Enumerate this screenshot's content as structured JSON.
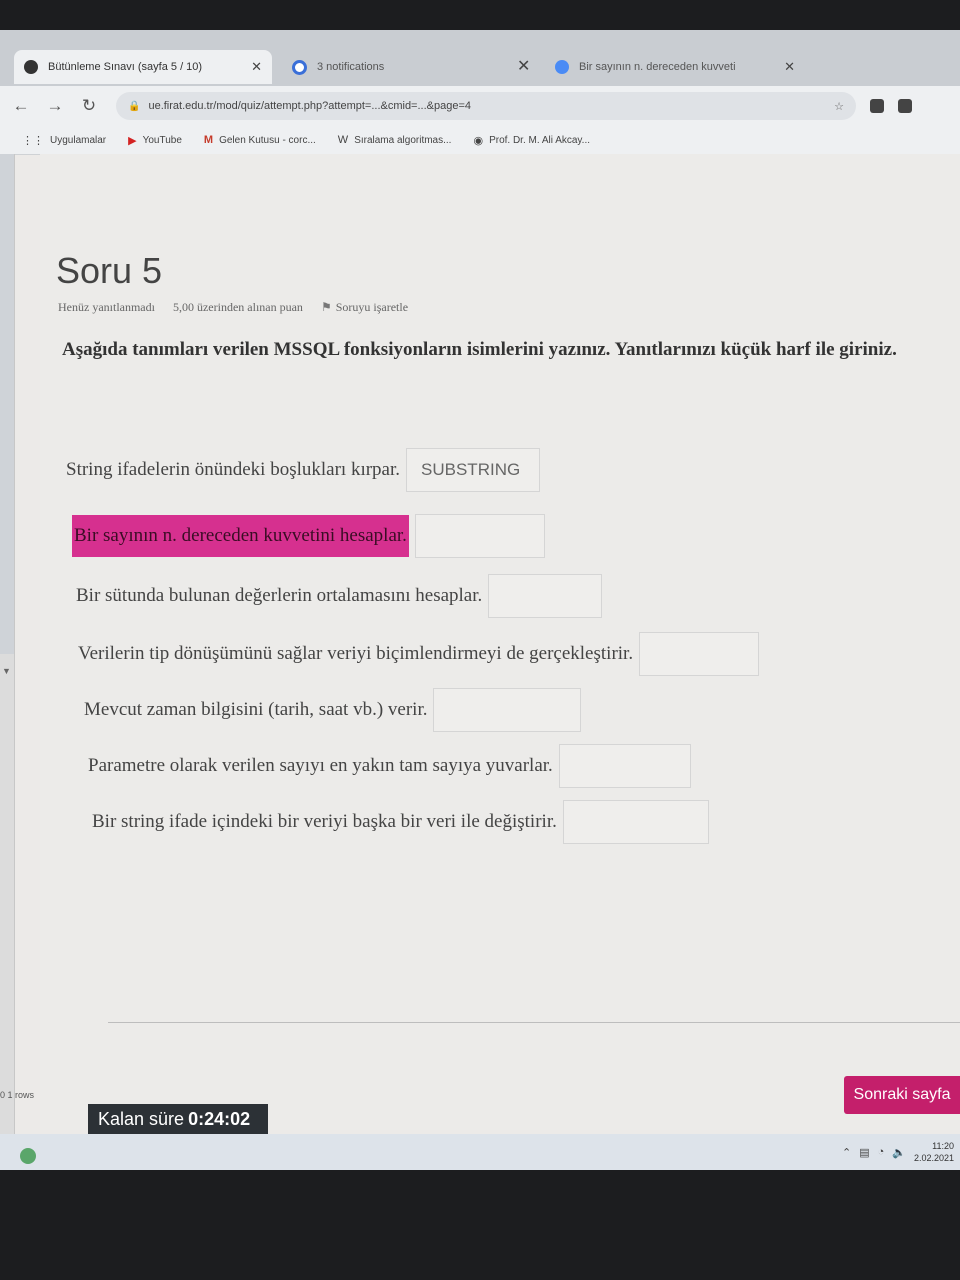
{
  "browser": {
    "tabs": [
      {
        "label": "Bütünleme Sınavı (sayfa 5 / 10)",
        "active": true
      },
      {
        "label": "3 notifications",
        "active": false
      },
      {
        "label": "Bir sayının n. dereceden kuvveti",
        "active": false
      }
    ],
    "url": "ue.firat.edu.tr/mod/quiz/attempt.php?attempt=...&cmid=...&page=4",
    "bookmarks": [
      {
        "label": "Uygulamalar",
        "icon": "apps-grid-icon"
      },
      {
        "label": "YouTube",
        "icon": "youtube-icon"
      },
      {
        "label": "Gelen Kutusu - corc...",
        "icon": "gmail-icon"
      },
      {
        "label": "Sıralama algoritmas...",
        "icon": "site-icon"
      },
      {
        "label": "Prof. Dr. M. Ali Akcay...",
        "icon": "globe-icon"
      }
    ]
  },
  "quiz": {
    "title": "Soru 5",
    "status": "Henüz yanıtlanmadı",
    "points": "5,00 üzerinden alınan puan",
    "flag_label": "Soruyu işaretle",
    "question": "Aşağıda tanımları verilen MSSQL fonksiyonların isimlerini yazınız. Yanıtlarınızı küçük harf ile giriniz.",
    "items": [
      {
        "label": "String ifadelerin önündeki boşlukları kırpar.",
        "value": "SUBSTRING"
      },
      {
        "label": "Bir sayının n. dereceden kuvvetini hesaplar.",
        "value": ""
      },
      {
        "label": "Bir sütunda bulunan değerlerin ortalamasını hesaplar.",
        "value": ""
      },
      {
        "label": "Verilerin tip dönüşümünü sağlar veriyi biçimlendirmeyi de gerçekleştirir.",
        "value": ""
      },
      {
        "label": "Mevcut zaman bilgisini (tarih, saat vb.) verir.",
        "value": ""
      },
      {
        "label": "Parametre olarak verilen sayıyı en yakın tam sayıya yuvarlar.",
        "value": ""
      },
      {
        "label": "Bir string ifade içindeki bir veriyi başka bir veri ile değiştirir.",
        "value": ""
      }
    ],
    "next_button": "Sonraki sayfa",
    "timer_label": "Kalan süre",
    "timer_value": "0:24:02"
  },
  "side": {
    "rows_info": "0   1 rows"
  },
  "taskbar": {
    "time": "11:20",
    "date": "2.02.2021"
  },
  "colors": {
    "highlight": "#d6308f",
    "next_button": "#c41f6b",
    "timer_bg": "#2c3136"
  }
}
